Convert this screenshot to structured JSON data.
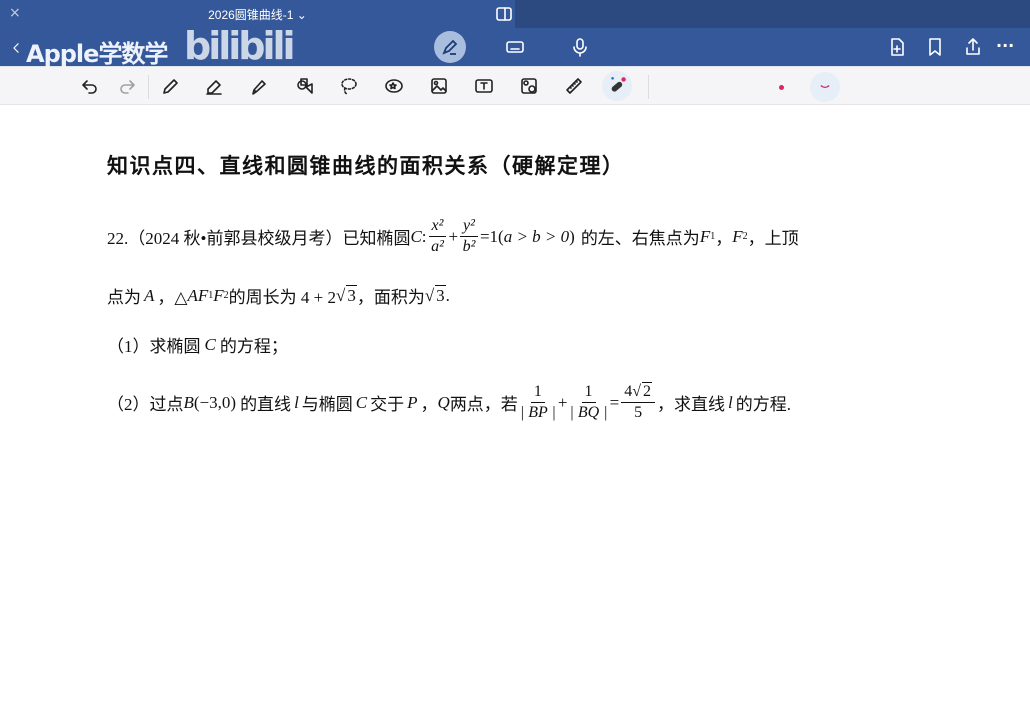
{
  "app": {
    "doc_title": "2026圆锥曲线-1 ⌄",
    "watermark": "Apple学数学",
    "bili": "bilibili",
    "close": "×",
    "more": "···"
  },
  "nav": {
    "icons": [
      "back-icon",
      "grid-icon",
      "search-icon",
      "pen-mode-icon",
      "keyboard-icon",
      "microphone-icon",
      "add-page-icon",
      "bookmark-icon",
      "share-icon",
      "more-icon"
    ]
  },
  "toolbar": {
    "tools": [
      "undo",
      "redo",
      "pen",
      "eraser",
      "highlighter",
      "shapes",
      "lasso",
      "sticker",
      "image",
      "text",
      "scan",
      "ruler",
      "laser-pointer"
    ],
    "accent": "#e0245e"
  },
  "doc": {
    "title": "知识点四、直线和圆锥曲线的面积关系（硬解定理）",
    "q": {
      "p1": "22.（2024 秋•前郭县校级月考）已知椭圆",
      "C": "C",
      "colon": ":",
      "x2": "x²",
      "a2": "a²",
      "plus": "+",
      "y2": "y²",
      "b2": "b²",
      "eq": "=1(",
      "cond": "a > b > 0",
      ")": ")",
      "p2": "的左、右焦点为",
      "F1": "F",
      "s1": "1",
      "comma": "，",
      "F2": "F",
      "s2": "2",
      "p3": "，上顶",
      "l2a": "点为",
      "A": "A",
      "l2b": "，△",
      "AF": "AF",
      "l2c": "的周长为 4 + 2",
      "r3": "3",
      "l2d": "，面积为",
      "r3b": "3",
      "dot": ".",
      "s1text": "（1）求椭圆",
      "s1C": "C",
      "s1end": "的方程；",
      "s2a": "（2）过点",
      "B": "B",
      "s2b": "(−3,0)",
      "s2c": "的直线",
      "l": "l",
      "s2d": "与椭圆",
      "s2C": "C",
      "s2e": "交于",
      "P": "P",
      "s2f": "，",
      "Q": "Q",
      "s2g": "两点，若",
      "one": "1",
      "BP": "| BP |",
      "BQ": "| BQ |",
      "four": "4",
      "two": "2",
      "five": "5",
      "eqs": "=",
      "s2h": "，求直线",
      "l2": "l",
      "s2i": "的方程."
    }
  }
}
